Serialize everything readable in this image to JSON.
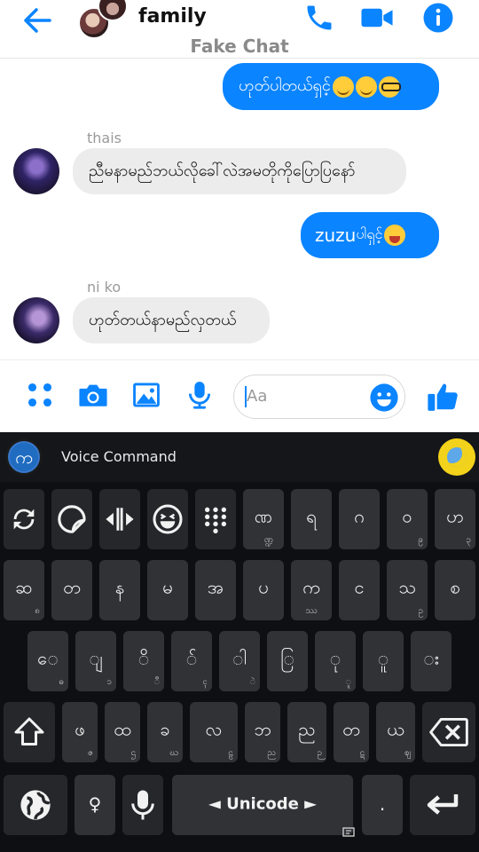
{
  "header": {
    "title": "family",
    "subtitle": "Fake Chat",
    "icons": [
      "back-arrow-icon",
      "phone-icon",
      "video-camera-icon",
      "info-icon"
    ],
    "accent": "#0b84ff"
  },
  "messages": [
    {
      "side": "me",
      "text": "ဟုတ်ပါတယ်ရှင့်",
      "emojis": [
        "hugging-face",
        "hugging-face",
        "nerd-face"
      ]
    },
    {
      "side": "them",
      "sender": "thais",
      "text": "ညီမနာမည်ဘယ်လိုခေါ်လဲအမတိုကိုပြောပြနော်"
    },
    {
      "side": "me",
      "text_latin": "zuzu",
      "text_rest": "ပါရှင့်",
      "emojis": [
        "winking-tongue-face"
      ]
    },
    {
      "side": "them",
      "sender": "ni ko",
      "text": "ဟုတ်တယ်နာမည်လှတယ်"
    }
  ],
  "composer": {
    "placeholder": "Aa",
    "icons": [
      "apps-grid-icon",
      "camera-icon",
      "image-icon",
      "microphone-icon",
      "emoji-icon",
      "thumbs-up-icon"
    ]
  },
  "keyboard": {
    "header_title": "Voice Command",
    "logo_letter": "က",
    "row1": [
      {
        "main": "ဏ",
        "sub": "ဏ္ဍ"
      },
      {
        "main": "ရ",
        "sub": ""
      },
      {
        "main": "ဂ",
        "sub": ""
      },
      {
        "main": "ဝ",
        "sub": "၉"
      },
      {
        "main": "ဟ",
        "sub": "၃"
      }
    ],
    "row2": [
      {
        "main": "ဆ",
        "sub": "၈"
      },
      {
        "main": "တ",
        "sub": ""
      },
      {
        "main": "န",
        "sub": ""
      },
      {
        "main": "မ",
        "sub": ""
      },
      {
        "main": "အ",
        "sub": ""
      },
      {
        "main": "ပ",
        "sub": ""
      },
      {
        "main": "က",
        "sub": "ဿ"
      },
      {
        "main": "င",
        "sub": ""
      },
      {
        "main": "သ",
        "sub": "ဥ"
      },
      {
        "main": "စ",
        "sub": ""
      }
    ],
    "row3": [
      {
        "main": "ေ",
        "sub": "ဓ"
      },
      {
        "main": "ျ",
        "sub": "၁"
      },
      {
        "main": "ိ",
        "sub": "ီ"
      },
      {
        "main": "်",
        "sub": "ၚ"
      },
      {
        "main": "ါ",
        "sub": "ဲ"
      },
      {
        "main": "ြ",
        "sub": ""
      },
      {
        "main": "ု",
        "sub": "ူ"
      },
      {
        "main": "ူ",
        "sub": ""
      },
      {
        "main": "း",
        "sub": ""
      }
    ],
    "row4": [
      {
        "main": "ဖ",
        "sub": "ဇ"
      },
      {
        "main": "ထ",
        "sub": "ဌ"
      },
      {
        "main": "ခ",
        "sub": "ဃ"
      },
      {
        "main": "လ",
        "sub": "ဠ"
      },
      {
        "main": "ဘ",
        "sub": "ည"
      },
      {
        "main": "ည",
        "sub": "ဉ"
      },
      {
        "main": "တ",
        "sub": "ဋ"
      },
      {
        "main": "ယ",
        "sub": "ဈ"
      }
    ],
    "space_label": "◄ Unicode ►",
    "period": ".",
    "shift_symbol": "♀"
  }
}
